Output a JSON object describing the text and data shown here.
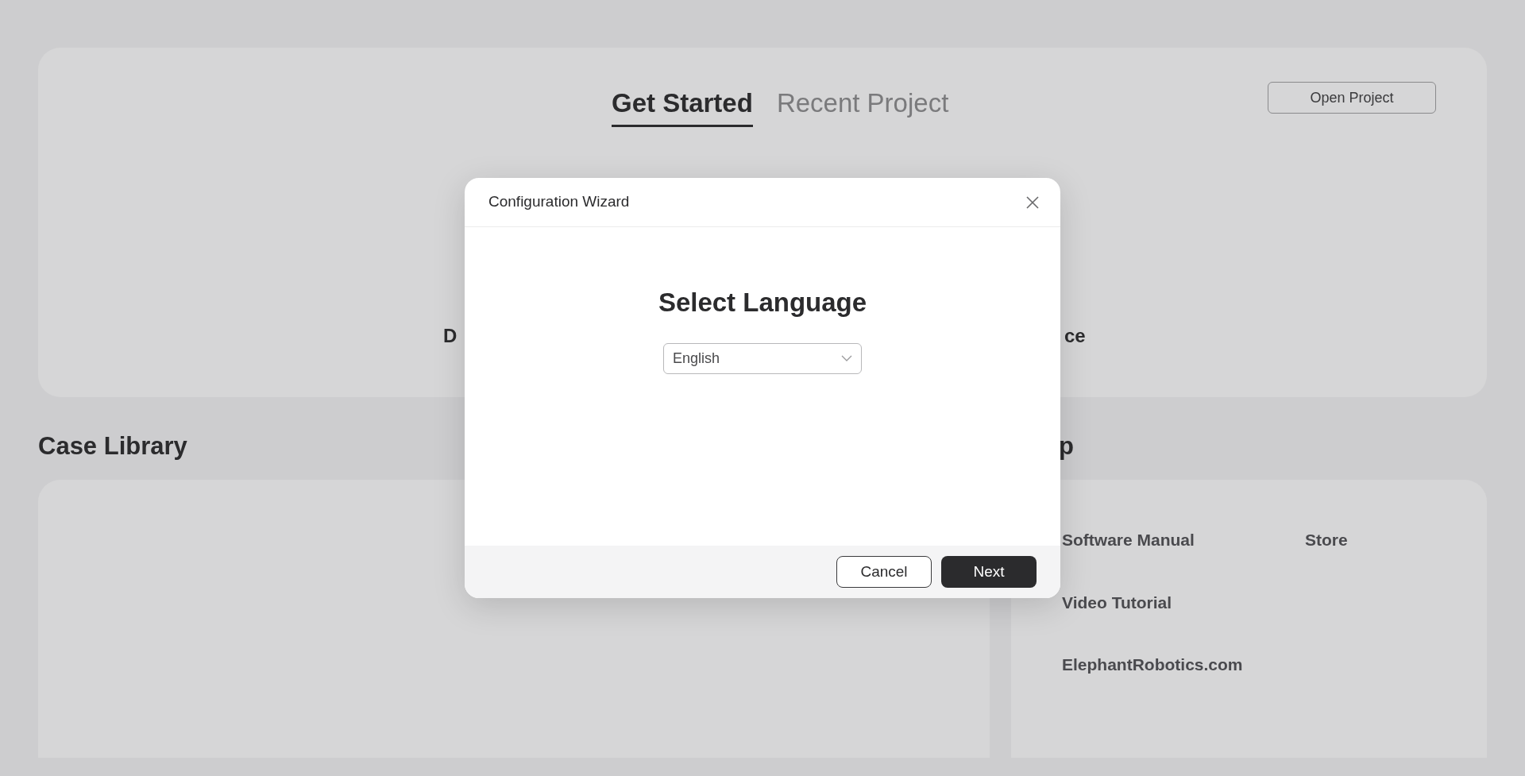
{
  "tabs": [
    {
      "label": "Get Started",
      "selected": true
    },
    {
      "label": "Recent Project",
      "selected": false
    }
  ],
  "open_project_button": "Open Project",
  "hidden_fragments": {
    "left": "D",
    "right": "ce"
  },
  "case_library": {
    "title": "Case Library"
  },
  "help": {
    "title_fragment": "p",
    "links": [
      {
        "label": "Software Manual"
      },
      {
        "label": "Store"
      },
      {
        "label": "Video Tutorial"
      },
      {
        "label": "ElephantRobotics.com"
      }
    ]
  },
  "dialog": {
    "title": "Configuration Wizard",
    "heading": "Select Language",
    "language_select": {
      "value": "English"
    },
    "buttons": [
      {
        "label": "Cancel",
        "kind": "secondary"
      },
      {
        "label": "Next",
        "kind": "primary"
      }
    ]
  }
}
